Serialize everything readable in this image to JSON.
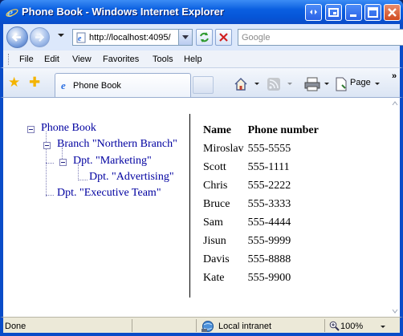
{
  "window": {
    "title": "Phone Book - Windows Internet Explorer"
  },
  "address_bar": {
    "url": "http://localhost:4095/",
    "search_placeholder": "Google"
  },
  "menu": [
    "File",
    "Edit",
    "View",
    "Favorites",
    "Tools",
    "Help"
  ],
  "tab": {
    "label": "Phone Book"
  },
  "command_bar": {
    "page_label": "Page",
    "chevron": "»"
  },
  "tree": {
    "root": "Phone Book",
    "branch": "Branch \"Northern Branch\"",
    "marketing": "Dpt. \"Marketing\"",
    "advertising": "Dpt. \"Advertising\"",
    "executive": "Dpt. \"Executive Team\""
  },
  "table": {
    "headers": [
      "Name",
      "Phone number"
    ],
    "rows": [
      [
        "Miroslav",
        "555-5555"
      ],
      [
        "Scott",
        "555-1111"
      ],
      [
        "Chris",
        "555-2222"
      ],
      [
        "Bruce",
        "555-3333"
      ],
      [
        "Sam",
        "555-4444"
      ],
      [
        "Jisun",
        "555-9999"
      ],
      [
        "Davis",
        "555-8888"
      ],
      [
        "Kate",
        "555-9900"
      ]
    ]
  },
  "status": {
    "text": "Done",
    "zone": "Local intranet",
    "zoom": "100%"
  },
  "colors": {
    "link": "#0000a0",
    "frame": "#0a4cc8",
    "titlebar": "#0656d8"
  }
}
